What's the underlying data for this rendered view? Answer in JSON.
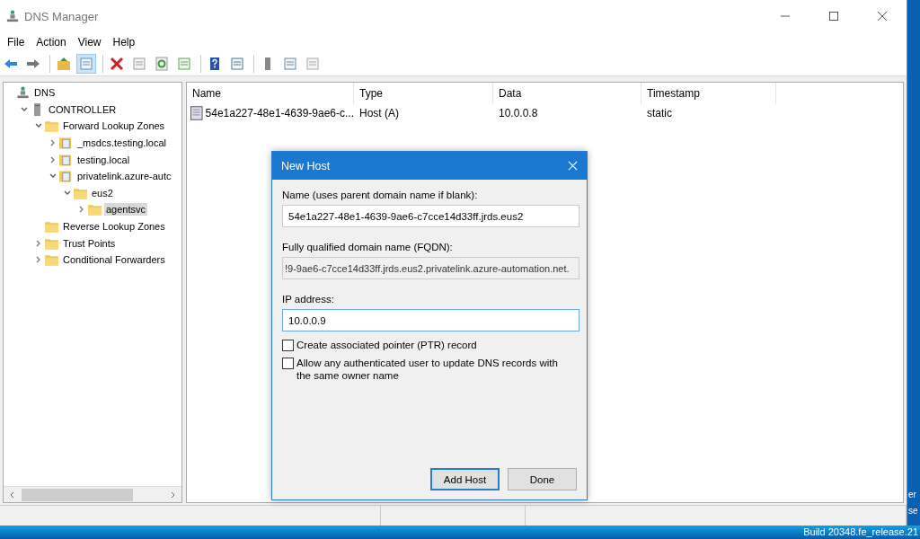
{
  "window": {
    "title": "DNS Manager"
  },
  "menu": [
    "File",
    "Action",
    "View",
    "Help"
  ],
  "toolbar": [
    {
      "kind": "back",
      "selected": false
    },
    {
      "kind": "forward",
      "selected": false
    },
    {
      "kind": "sep"
    },
    {
      "kind": "up",
      "selected": false
    },
    {
      "kind": "tree",
      "selected": true
    },
    {
      "kind": "sep"
    },
    {
      "kind": "delete",
      "selected": false
    },
    {
      "kind": "props",
      "selected": false
    },
    {
      "kind": "refresh",
      "selected": false
    },
    {
      "kind": "export",
      "selected": false
    },
    {
      "kind": "sep"
    },
    {
      "kind": "help",
      "selected": false
    },
    {
      "kind": "pane",
      "selected": false
    },
    {
      "kind": "sep"
    },
    {
      "kind": "server",
      "selected": false
    },
    {
      "kind": "list",
      "selected": false
    },
    {
      "kind": "copy",
      "selected": false
    }
  ],
  "tree": [
    {
      "label": "DNS",
      "kind": "dns",
      "selected": false,
      "children": [
        {
          "label": "CONTROLLER",
          "kind": "server",
          "selected": false,
          "expanded": true,
          "children": [
            {
              "label": "Forward Lookup Zones",
              "kind": "folder",
              "selected": false,
              "expanded": true,
              "children": [
                {
                  "label": "_msdcs.testing.local",
                  "kind": "zone",
                  "selected": false,
                  "expanded": false
                },
                {
                  "label": "testing.local",
                  "kind": "zone",
                  "selected": false,
                  "expanded": false
                },
                {
                  "label": "privatelink.azure-autc",
                  "kind": "zone",
                  "selected": false,
                  "expanded": true,
                  "children": [
                    {
                      "label": "eus2",
                      "kind": "folder",
                      "selected": false,
                      "expanded": true,
                      "children": [
                        {
                          "label": "agentsvc",
                          "kind": "folder",
                          "selected": true,
                          "expanded": false
                        }
                      ]
                    }
                  ]
                }
              ]
            },
            {
              "label": "Reverse Lookup Zones",
              "kind": "folder",
              "selected": false
            },
            {
              "label": "Trust Points",
              "kind": "folder",
              "selected": false,
              "expanded": false
            },
            {
              "label": "Conditional Forwarders",
              "kind": "folder",
              "selected": false,
              "expanded": false
            }
          ]
        }
      ]
    }
  ],
  "table": {
    "columns": [
      "Name",
      "Type",
      "Data",
      "Timestamp"
    ],
    "rows": [
      [
        "54e1a227-48e1-4639-9ae6-c...",
        "Host (A)",
        "10.0.0.8",
        "static"
      ]
    ]
  },
  "dialog": {
    "title": "New Host",
    "name_label": "Name (uses parent domain name if blank):",
    "name_value": "54e1a227-48e1-4639-9ae6-c7cce14d33ff.jrds.eus2",
    "fqdn_label": "Fully qualified domain name (FQDN):",
    "fqdn_value": "!9-9ae6-c7cce14d33ff.jrds.eus2.privatelink.azure-automation.net.",
    "ip_label": "IP address:",
    "ip_value": "10.0.0.9",
    "checkboxes": [
      {
        "label": "Create associated pointer (PTR) record",
        "checked": false
      },
      {
        "label": "Allow any authenticated user to update DNS records with the same owner name",
        "checked": false
      }
    ],
    "buttons": [
      {
        "label": "Add Host",
        "default": true
      },
      {
        "label": "Done",
        "default": false
      }
    ]
  },
  "desktop": {
    "texts": [
      "er",
      "se",
      "Build 20348.fe_release.21"
    ]
  }
}
